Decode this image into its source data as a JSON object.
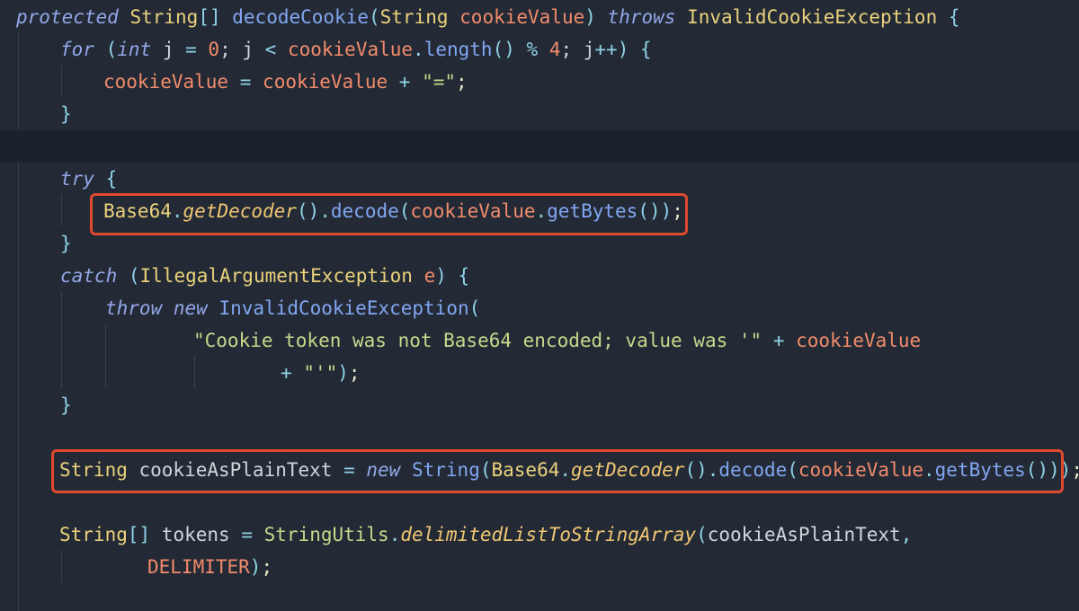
{
  "editor": {
    "lines": [
      {
        "tokens": [
          {
            "t": "protected",
            "c": "kw"
          },
          {
            "t": " ",
            "c": "pl"
          },
          {
            "t": "String",
            "c": "ty"
          },
          {
            "t": "[]",
            "c": "pu"
          },
          {
            "t": " ",
            "c": "pl"
          },
          {
            "t": "decodeCookie",
            "c": "fn"
          },
          {
            "t": "(",
            "c": "pu"
          },
          {
            "t": "String",
            "c": "ty"
          },
          {
            "t": " ",
            "c": "pl"
          },
          {
            "t": "cookieValue",
            "c": "pr"
          },
          {
            "t": ")",
            "c": "pu"
          },
          {
            "t": " ",
            "c": "pl"
          },
          {
            "t": "throws",
            "c": "kw"
          },
          {
            "t": " ",
            "c": "pl"
          },
          {
            "t": "InvalidCookieException",
            "c": "ty"
          },
          {
            "t": " {",
            "c": "pu"
          }
        ]
      },
      {
        "tokens": [
          {
            "t": "for",
            "c": "kw"
          },
          {
            "t": " (",
            "c": "pu"
          },
          {
            "t": "int",
            "c": "kw"
          },
          {
            "t": " j ",
            "c": "pl"
          },
          {
            "t": "=",
            "c": "op"
          },
          {
            "t": " ",
            "c": "pl"
          },
          {
            "t": "0",
            "c": "nu"
          },
          {
            "t": "; j ",
            "c": "pl"
          },
          {
            "t": "<",
            "c": "op"
          },
          {
            "t": " ",
            "c": "pl"
          },
          {
            "t": "cookieValue",
            "c": "pr"
          },
          {
            "t": ".",
            "c": "pu"
          },
          {
            "t": "length",
            "c": "fn"
          },
          {
            "t": "() ",
            "c": "pu"
          },
          {
            "t": "%",
            "c": "op"
          },
          {
            "t": " ",
            "c": "pl"
          },
          {
            "t": "4",
            "c": "nu"
          },
          {
            "t": "; j",
            "c": "pl"
          },
          {
            "t": "++",
            "c": "op"
          },
          {
            "t": ") {",
            "c": "pu"
          }
        ]
      },
      {
        "tokens": [
          {
            "t": "cookieValue",
            "c": "pr"
          },
          {
            "t": " ",
            "c": "pl"
          },
          {
            "t": "=",
            "c": "op"
          },
          {
            "t": " ",
            "c": "pl"
          },
          {
            "t": "cookieValue",
            "c": "pr"
          },
          {
            "t": " ",
            "c": "pl"
          },
          {
            "t": "+",
            "c": "op"
          },
          {
            "t": " ",
            "c": "pl"
          },
          {
            "t": "\"=\"",
            "c": "st"
          },
          {
            "t": ";",
            "c": "sm"
          }
        ]
      },
      {
        "tokens": [
          {
            "t": "}",
            "c": "pu"
          }
        ]
      },
      {
        "tokens": []
      },
      {
        "tokens": [
          {
            "t": "try",
            "c": "kw"
          },
          {
            "t": " {",
            "c": "pu"
          }
        ]
      },
      {
        "tokens": [
          {
            "t": "Base64",
            "c": "ty"
          },
          {
            "t": ".",
            "c": "pu"
          },
          {
            "t": "getDecoder",
            "c": "it"
          },
          {
            "t": "().",
            "c": "pu"
          },
          {
            "t": "decode",
            "c": "fn"
          },
          {
            "t": "(",
            "c": "pu"
          },
          {
            "t": "cookieValue",
            "c": "pr"
          },
          {
            "t": ".",
            "c": "pu"
          },
          {
            "t": "getBytes",
            "c": "fn"
          },
          {
            "t": "())",
            "c": "pu"
          },
          {
            "t": ";",
            "c": "sm"
          }
        ]
      },
      {
        "tokens": [
          {
            "t": "}",
            "c": "pu"
          }
        ]
      },
      {
        "tokens": [
          {
            "t": "catch",
            "c": "kw"
          },
          {
            "t": " (",
            "c": "pu"
          },
          {
            "t": "IllegalArgumentException",
            "c": "ty"
          },
          {
            "t": " ",
            "c": "pl"
          },
          {
            "t": "e",
            "c": "pr"
          },
          {
            "t": ") {",
            "c": "pu"
          }
        ]
      },
      {
        "tokens": [
          {
            "t": "throw",
            "c": "kw"
          },
          {
            "t": " ",
            "c": "pl"
          },
          {
            "t": "new",
            "c": "kw"
          },
          {
            "t": " ",
            "c": "pl"
          },
          {
            "t": "InvalidCookieException",
            "c": "fn"
          },
          {
            "t": "(",
            "c": "pu"
          }
        ]
      },
      {
        "tokens": [
          {
            "t": "\"Cookie token was not Base64 encoded; value was '\"",
            "c": "st"
          },
          {
            "t": " ",
            "c": "pl"
          },
          {
            "t": "+",
            "c": "op"
          },
          {
            "t": " ",
            "c": "pl"
          },
          {
            "t": "cookieValue",
            "c": "pr"
          }
        ]
      },
      {
        "tokens": [
          {
            "t": "+",
            "c": "op"
          },
          {
            "t": " ",
            "c": "pl"
          },
          {
            "t": "\"'\"",
            "c": "st"
          },
          {
            "t": ")",
            "c": "pu"
          },
          {
            "t": ";",
            "c": "sm"
          }
        ]
      },
      {
        "tokens": [
          {
            "t": "}",
            "c": "pu"
          }
        ]
      },
      {
        "tokens": []
      },
      {
        "tokens": [
          {
            "t": "String",
            "c": "ty"
          },
          {
            "t": " cookieAsPlainText ",
            "c": "pl"
          },
          {
            "t": "=",
            "c": "op"
          },
          {
            "t": " ",
            "c": "pl"
          },
          {
            "t": "new",
            "c": "kw"
          },
          {
            "t": " ",
            "c": "pl"
          },
          {
            "t": "String",
            "c": "fn"
          },
          {
            "t": "(",
            "c": "pu"
          },
          {
            "t": "Base64",
            "c": "ty"
          },
          {
            "t": ".",
            "c": "pu"
          },
          {
            "t": "getDecoder",
            "c": "it"
          },
          {
            "t": "().",
            "c": "pu"
          },
          {
            "t": "decode",
            "c": "fn"
          },
          {
            "t": "(",
            "c": "pu"
          },
          {
            "t": "cookieValue",
            "c": "pr"
          },
          {
            "t": ".",
            "c": "pu"
          },
          {
            "t": "getBytes",
            "c": "fn"
          },
          {
            "t": "()))",
            "c": "pu"
          },
          {
            "t": ";",
            "c": "sm"
          }
        ]
      },
      {
        "tokens": []
      },
      {
        "tokens": [
          {
            "t": "String",
            "c": "ty"
          },
          {
            "t": "[]",
            "c": "pu"
          },
          {
            "t": " tokens ",
            "c": "pl"
          },
          {
            "t": "=",
            "c": "op"
          },
          {
            "t": " ",
            "c": "pl"
          },
          {
            "t": "StringUtils",
            "c": "st"
          },
          {
            "t": ".",
            "c": "pu"
          },
          {
            "t": "delimitedListToStringArray",
            "c": "it"
          },
          {
            "t": "(",
            "c": "pu"
          },
          {
            "t": "cookieAsPlainText",
            "c": "pl"
          },
          {
            "t": ",",
            "c": "pu"
          }
        ]
      },
      {
        "tokens": [
          {
            "t": "DELIMITER",
            "c": "co"
          },
          {
            "t": ")",
            "c": "pu"
          },
          {
            "t": ";",
            "c": "sm"
          }
        ]
      }
    ]
  }
}
